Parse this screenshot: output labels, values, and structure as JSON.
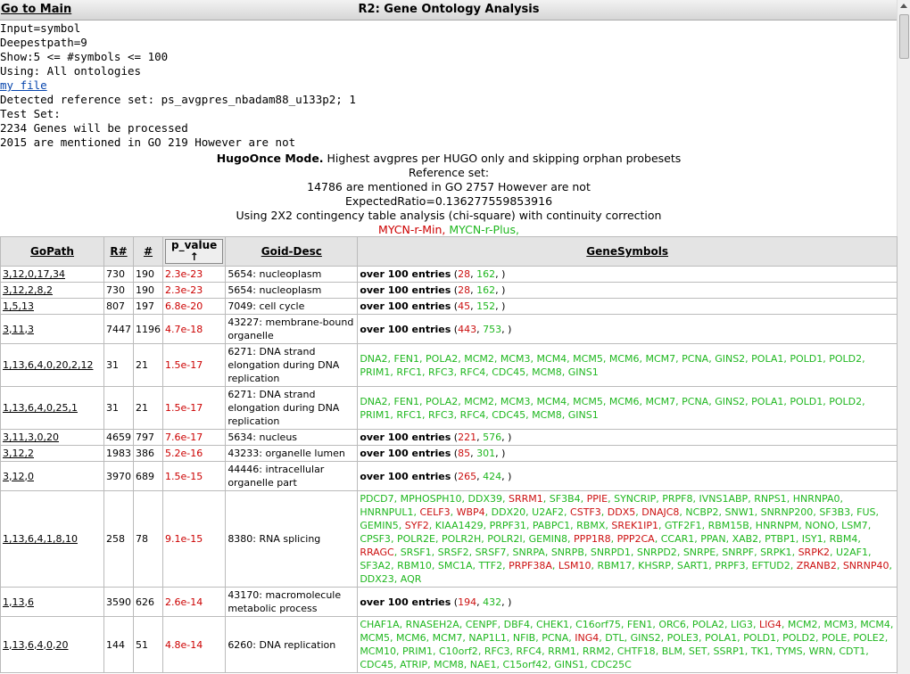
{
  "header": {
    "goto_label": "Go to Main",
    "title": "R2: Gene Ontology Analysis"
  },
  "info": {
    "input": "Input=symbol",
    "deepest": "Deepestpath=9",
    "show": "Show:5 <= #symbols <= 100",
    "using": "Using: All ontologies",
    "myfile": "my file",
    "detected": "Detected reference set: ps_avgpres_nbadam88_u133p2; 1",
    "testset": "Test Set:",
    "genes": "2234 Genes will be processed",
    "mentioned": "2015 are mentioned in GO 219 However are not"
  },
  "center": {
    "mode_bold": "HugoOnce Mode.",
    "mode_rest": " Highest avgpres per HUGO only and skipping orphan probesets",
    "refset": "Reference set:",
    "ref_mentioned": "14786 are mentioned in GO 2757 However are not",
    "ratio": "ExpectedRatio=0.136277559853916",
    "using2x2": "Using 2X2 contingency table analysis (chi-square) with continuity correction",
    "legend_min": "MYCN-r-Min,",
    "legend_plus": "MYCN-r-Plus,"
  },
  "colors": {
    "min": "#cc1111",
    "plus": "#1fb71f"
  },
  "table": {
    "headers": {
      "gopath": "GoPath",
      "r": "R#",
      "n": "#",
      "pvalue": "p_value",
      "sort_arrow": "↑",
      "desc": "Goid-Desc",
      "genes": "GeneSymbols"
    },
    "rows": [
      {
        "path": "3,12,0,17,34",
        "r": "730",
        "n": "190",
        "p": "2.3e-23",
        "desc": "5654: nucleoplasm",
        "over": "over 100 entries",
        "min": "28",
        "plus": "162"
      },
      {
        "path": "3,12,2,8,2",
        "r": "730",
        "n": "190",
        "p": "2.3e-23",
        "desc": "5654: nucleoplasm",
        "over": "over 100 entries",
        "min": "28",
        "plus": "162"
      },
      {
        "path": "1,5,13",
        "r": "807",
        "n": "197",
        "p": "6.8e-20",
        "desc": "7049: cell cycle",
        "over": "over 100 entries",
        "min": "45",
        "plus": "152"
      },
      {
        "path": "3,11,3",
        "r": "7447",
        "n": "1196",
        "p": "4.7e-18",
        "desc": "43227: membrane-bound organelle",
        "over": "over 100 entries",
        "min": "443",
        "plus": "753"
      },
      {
        "path": "1,13,6,4,0,20,2,12",
        "r": "31",
        "n": "21",
        "p": "1.5e-17",
        "desc": "6271: DNA strand elongation during DNA replication",
        "genes": "DNA2, FEN1, POLA2, MCM2, MCM3, MCM4, MCM5, MCM6, MCM7, PCNA, GINS2, POLA1, POLD1, POLD2, PRIM1, RFC1, RFC3, RFC4, CDC45, MCM8, GINS1"
      },
      {
        "path": "1,13,6,4,0,25,1",
        "r": "31",
        "n": "21",
        "p": "1.5e-17",
        "desc": "6271: DNA strand elongation during DNA replication",
        "genes": "DNA2, FEN1, POLA2, MCM2, MCM3, MCM4, MCM5, MCM6, MCM7, PCNA, GINS2, POLA1, POLD1, POLD2, PRIM1, RFC1, RFC3, RFC4, CDC45, MCM8, GINS1"
      },
      {
        "path": "3,11,3,0,20",
        "r": "4659",
        "n": "797",
        "p": "7.6e-17",
        "desc": "5634: nucleus",
        "over": "over 100 entries",
        "min": "221",
        "plus": "576"
      },
      {
        "path": "3,12,2",
        "r": "1983",
        "n": "386",
        "p": "5.2e-16",
        "desc": "43233: organelle lumen",
        "over": "over 100 entries",
        "min": "85",
        "plus": "301"
      },
      {
        "path": "3,12,0",
        "r": "3970",
        "n": "689",
        "p": "1.5e-15",
        "desc": "44446: intracellular organelle part",
        "over": "over 100 entries",
        "min": "265",
        "plus": "424"
      },
      {
        "path": "1,13,6,4,1,8,10",
        "r": "258",
        "n": "78",
        "p": "9.1e-15",
        "desc": "8380: RNA splicing",
        "gene_list": [
          [
            "PDCD7",
            "g"
          ],
          [
            "MPHOSPH10",
            "g"
          ],
          [
            "DDX39",
            "g"
          ],
          [
            "SRRM1",
            "r"
          ],
          [
            "SF3B4",
            "g"
          ],
          [
            "PPIE",
            "r"
          ],
          [
            "SYNCRIP",
            "g"
          ],
          [
            "PRPF8",
            "g"
          ],
          [
            "IVNS1ABP",
            "g"
          ],
          [
            "RNPS1",
            "g"
          ],
          [
            "HNRNPA0",
            "g"
          ],
          [
            "HNRNPUL1",
            "g"
          ],
          [
            "CELF3",
            "r"
          ],
          [
            "WBP4",
            "r"
          ],
          [
            "DDX20",
            "g"
          ],
          [
            "U2AF2",
            "g"
          ],
          [
            "CSTF3",
            "r"
          ],
          [
            "DDX5",
            "r"
          ],
          [
            "DNAJC8",
            "r"
          ],
          [
            "NCBP2",
            "g"
          ],
          [
            "SNW1",
            "g"
          ],
          [
            "SNRNP200",
            "g"
          ],
          [
            "SF3B3",
            "g"
          ],
          [
            "FUS",
            "g"
          ],
          [
            "GEMIN5",
            "g"
          ],
          [
            "SYF2",
            "r"
          ],
          [
            "KIAA1429",
            "g"
          ],
          [
            "PRPF31",
            "g"
          ],
          [
            "PABPC1",
            "g"
          ],
          [
            "RBMX",
            "g"
          ],
          [
            "SREK1IP1",
            "r"
          ],
          [
            "GTF2F1",
            "g"
          ],
          [
            "RBM15B",
            "g"
          ],
          [
            "HNRNPM",
            "g"
          ],
          [
            "NONO",
            "g"
          ],
          [
            "LSM7",
            "g"
          ],
          [
            "CPSF3",
            "g"
          ],
          [
            "POLR2E",
            "g"
          ],
          [
            "POLR2H",
            "g"
          ],
          [
            "POLR2I",
            "g"
          ],
          [
            "GEMIN8",
            "g"
          ],
          [
            "PPP1R8",
            "r"
          ],
          [
            "PPP2CA",
            "r"
          ],
          [
            "CCAR1",
            "g"
          ],
          [
            "PPAN",
            "g"
          ],
          [
            "XAB2",
            "g"
          ],
          [
            "PTBP1",
            "g"
          ],
          [
            "ISY1",
            "g"
          ],
          [
            "RBM4",
            "g"
          ],
          [
            "RRAGC",
            "r"
          ],
          [
            "SRSF1",
            "g"
          ],
          [
            "SRSF2",
            "g"
          ],
          [
            "SRSF7",
            "g"
          ],
          [
            "SNRPA",
            "g"
          ],
          [
            "SNRPB",
            "g"
          ],
          [
            "SNRPD1",
            "g"
          ],
          [
            "SNRPD2",
            "g"
          ],
          [
            "SNRPE",
            "g"
          ],
          [
            "SNRPF",
            "g"
          ],
          [
            "SRPK1",
            "g"
          ],
          [
            "SRPK2",
            "r"
          ],
          [
            "U2AF1",
            "g"
          ],
          [
            "SF3A2",
            "g"
          ],
          [
            "RBM10",
            "g"
          ],
          [
            "SMC1A",
            "g"
          ],
          [
            "TTF2",
            "g"
          ],
          [
            "PRPF38A",
            "r"
          ],
          [
            "LSM10",
            "r"
          ],
          [
            "RBM17",
            "g"
          ],
          [
            "KHSRP",
            "g"
          ],
          [
            "SART1",
            "g"
          ],
          [
            "PRPF3",
            "g"
          ],
          [
            "EFTUD2",
            "g"
          ],
          [
            "ZRANB2",
            "r"
          ],
          [
            "SNRNP40",
            "r"
          ],
          [
            "DDX23",
            "g"
          ],
          [
            "AQR",
            "g"
          ]
        ]
      },
      {
        "path": "1,13,6",
        "r": "3590",
        "n": "626",
        "p": "2.6e-14",
        "desc": "43170: macromolecule metabolic process",
        "over": "over 100 entries",
        "min": "194",
        "plus": "432"
      },
      {
        "path": "1,13,6,4,0,20",
        "r": "144",
        "n": "51",
        "p": "4.8e-14",
        "desc": "6260: DNA replication",
        "gene_list": [
          [
            "CHAF1A",
            "g"
          ],
          [
            "RNASEH2A",
            "g"
          ],
          [
            "CENPF",
            "g"
          ],
          [
            "DBF4",
            "g"
          ],
          [
            "CHEK1",
            "g"
          ],
          [
            "C16orf75",
            "g"
          ],
          [
            "FEN1",
            "g"
          ],
          [
            "ORC6",
            "g"
          ],
          [
            "POLA2",
            "g"
          ],
          [
            "LIG3",
            "g"
          ],
          [
            "LIG4",
            "r"
          ],
          [
            "MCM2",
            "g"
          ],
          [
            "MCM3",
            "g"
          ],
          [
            "MCM4",
            "g"
          ],
          [
            "MCM5",
            "g"
          ],
          [
            "MCM6",
            "g"
          ],
          [
            "MCM7",
            "g"
          ],
          [
            "NAP1L1",
            "g"
          ],
          [
            "NFIB",
            "g"
          ],
          [
            "PCNA",
            "g"
          ],
          [
            "ING4",
            "r"
          ],
          [
            "DTL",
            "g"
          ],
          [
            "GINS2",
            "g"
          ],
          [
            "POLE3",
            "g"
          ],
          [
            "POLA1",
            "g"
          ],
          [
            "POLD1",
            "g"
          ],
          [
            "POLD2",
            "g"
          ],
          [
            "POLE",
            "g"
          ],
          [
            "POLE2",
            "g"
          ],
          [
            "MCM10",
            "g"
          ],
          [
            "PRIM1",
            "g"
          ],
          [
            "C10orf2",
            "g"
          ],
          [
            "RFC3",
            "g"
          ],
          [
            "RFC4",
            "g"
          ],
          [
            "RRM1",
            "g"
          ],
          [
            "RRM2",
            "g"
          ],
          [
            "CHTF18",
            "g"
          ],
          [
            "BLM",
            "g"
          ],
          [
            "SET",
            "g"
          ],
          [
            "SSRP1",
            "g"
          ],
          [
            "TK1",
            "g"
          ],
          [
            "TYMS",
            "g"
          ],
          [
            "WRN",
            "g"
          ],
          [
            "CDT1",
            "g"
          ],
          [
            "CDC45",
            "g"
          ],
          [
            "ATRIP",
            "g"
          ],
          [
            "MCM8",
            "g"
          ],
          [
            "NAE1",
            "g"
          ],
          [
            "C15orf42",
            "g"
          ],
          [
            "GINS1",
            "g"
          ],
          [
            "CDC25C",
            "g"
          ]
        ]
      }
    ]
  }
}
